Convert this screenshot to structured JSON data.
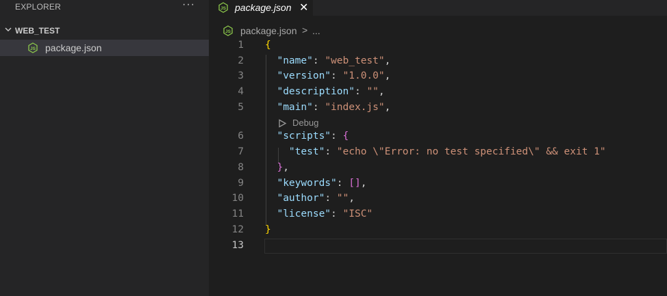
{
  "sidebar": {
    "title": "EXPLORER",
    "more_label": "···",
    "section": "WEB_TEST",
    "files": [
      {
        "name": "package.json",
        "icon": "nodejs-icon"
      }
    ]
  },
  "tab": {
    "label": "package.json",
    "close": "✕",
    "icon": "nodejs-icon"
  },
  "breadcrumb": {
    "file": "package.json",
    "separator": ">",
    "more": "..."
  },
  "codelens": {
    "label": "Debug",
    "icon": "play-outline-icon"
  },
  "editor": {
    "active_line": 13,
    "lines": [
      {
        "n": "1",
        "tokens": [
          [
            "b1",
            "{"
          ]
        ]
      },
      {
        "n": "2",
        "tokens": [
          [
            "p",
            "  "
          ],
          [
            "k",
            "\"name\""
          ],
          [
            "p",
            ": "
          ],
          [
            "s",
            "\"web_test\""
          ],
          [
            "p",
            ","
          ]
        ]
      },
      {
        "n": "3",
        "tokens": [
          [
            "p",
            "  "
          ],
          [
            "k",
            "\"version\""
          ],
          [
            "p",
            ": "
          ],
          [
            "s",
            "\"1.0.0\""
          ],
          [
            "p",
            ","
          ]
        ]
      },
      {
        "n": "4",
        "tokens": [
          [
            "p",
            "  "
          ],
          [
            "k",
            "\"description\""
          ],
          [
            "p",
            ": "
          ],
          [
            "s",
            "\"\""
          ],
          [
            "p",
            ","
          ]
        ]
      },
      {
        "n": "5",
        "tokens": [
          [
            "p",
            "  "
          ],
          [
            "k",
            "\"main\""
          ],
          [
            "p",
            ": "
          ],
          [
            "s",
            "\"index.js\""
          ],
          [
            "p",
            ","
          ]
        ]
      },
      {
        "n": "6",
        "tokens": [
          [
            "p",
            "  "
          ],
          [
            "k",
            "\"scripts\""
          ],
          [
            "p",
            ": "
          ],
          [
            "b2",
            "{"
          ]
        ]
      },
      {
        "n": "7",
        "tokens": [
          [
            "p",
            "    "
          ],
          [
            "k",
            "\"test\""
          ],
          [
            "p",
            ": "
          ],
          [
            "s",
            "\"echo \\\"Error: no test specified\\\" && exit 1\""
          ]
        ]
      },
      {
        "n": "8",
        "tokens": [
          [
            "p",
            "  "
          ],
          [
            "b2",
            "}"
          ],
          [
            "p",
            ","
          ]
        ]
      },
      {
        "n": "9",
        "tokens": [
          [
            "p",
            "  "
          ],
          [
            "k",
            "\"keywords\""
          ],
          [
            "p",
            ": "
          ],
          [
            "b2",
            "[]"
          ],
          [
            "p",
            ","
          ]
        ]
      },
      {
        "n": "10",
        "tokens": [
          [
            "p",
            "  "
          ],
          [
            "k",
            "\"author\""
          ],
          [
            "p",
            ": "
          ],
          [
            "s",
            "\"\""
          ],
          [
            "p",
            ","
          ]
        ]
      },
      {
        "n": "11",
        "tokens": [
          [
            "p",
            "  "
          ],
          [
            "k",
            "\"license\""
          ],
          [
            "p",
            ": "
          ],
          [
            "s",
            "\"ISC\""
          ]
        ]
      },
      {
        "n": "12",
        "tokens": [
          [
            "b1",
            "}"
          ]
        ]
      },
      {
        "n": "13",
        "tokens": []
      }
    ]
  },
  "colors": {
    "key": "#9cdcfe",
    "string": "#ce9178",
    "punct": "#d4d4d4",
    "bracket1": "#ffd700",
    "bracket2": "#da70d6",
    "js_icon": "#8cc84b"
  }
}
